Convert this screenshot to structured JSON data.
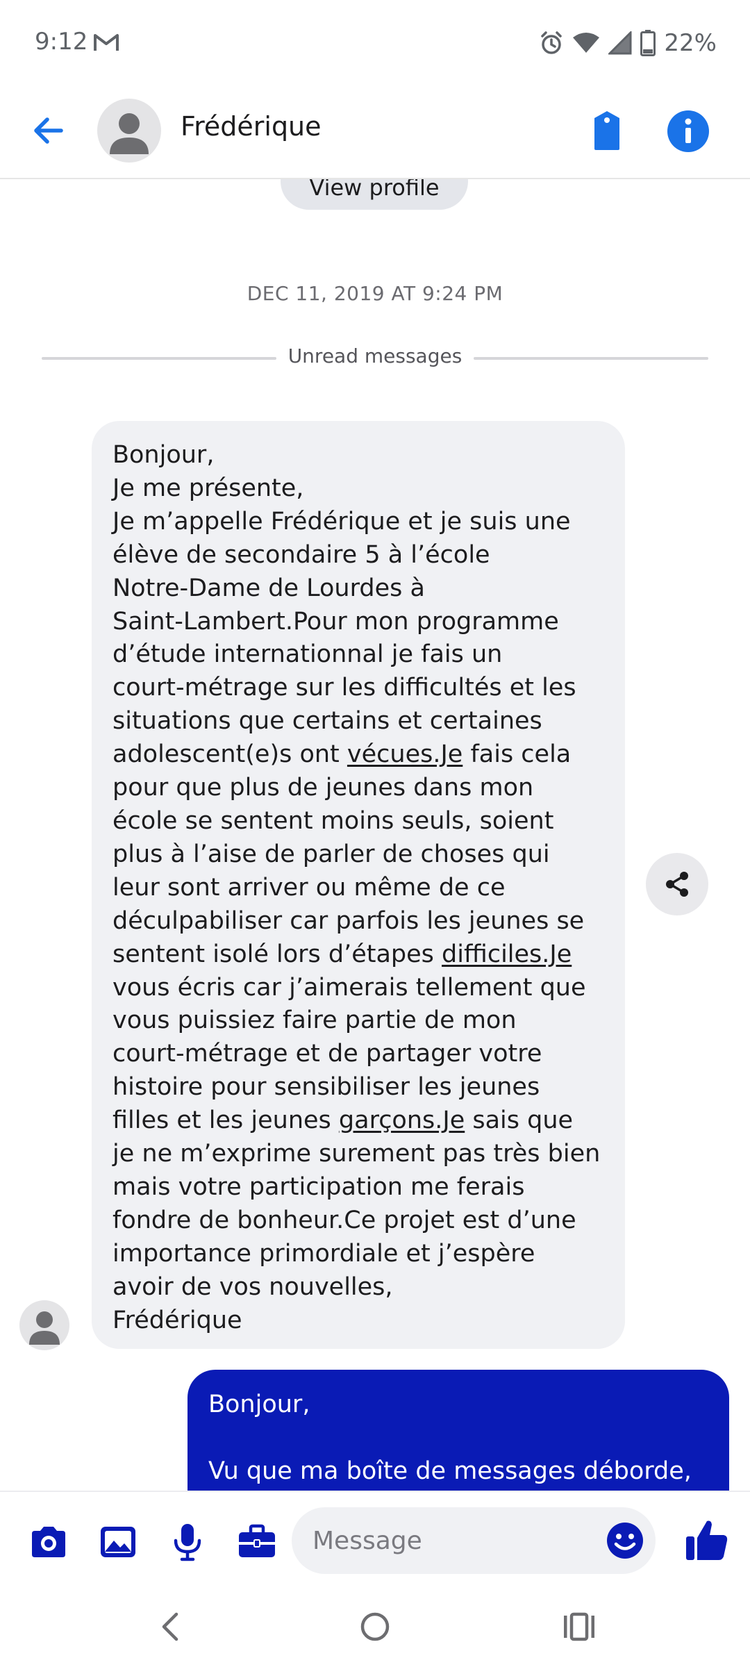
{
  "status_bar": {
    "time": "9:12",
    "battery": "22%"
  },
  "header": {
    "contact_name": "Frédérique"
  },
  "chat": {
    "view_profile_label": "View profile",
    "timestamp": "DEC 11, 2019 AT 9:24 PM",
    "unread_label": "Unread messages",
    "incoming_message": {
      "lines": [
        "Bonjour,",
        "Je me présente,",
        "Je  m’appelle Frédérique et je suis une",
        "élève de secondaire 5 à l’école",
        "Notre-Dame de Lourdes à",
        "Saint-Lambert.Pour mon programme",
        "d’étude internationnal je fais un",
        "court-métrage sur les difficultés et les",
        "situations que certains et certaines",
        "adolescent(e)s ont vécues.Je fais cela",
        "pour que plus de jeunes dans mon",
        "école se sentent moins seuls, soient",
        "plus à l’aise de parler de choses qui",
        "leur sont arriver ou même de ce",
        "déculpabiliser car parfois les jeunes se",
        "sentent isolé lors d’étapes difficiles.Je",
        "vous écris car j’aimerais tellement que",
        "vous puissiez faire partie de mon",
        "court-métrage et de partager votre",
        "histoire pour sensibiliser les jeunes",
        "filles et les jeunes garçons.Je sais que",
        "je ne m’exprime surement pas très bien",
        "mais votre participation me ferais",
        "fondre de bonheur.Ce projet est d’une",
        "importance primordiale et j’espère",
        "avoir de vos nouvelles,",
        "Frédérique"
      ]
    },
    "outgoing_message": {
      "line1": "Bonjour,",
      "line2": "Vu que ma boîte de messages déborde,"
    }
  },
  "composer": {
    "placeholder": "Message"
  },
  "colors": {
    "accent": "#1a73e8",
    "outgoing_bubble": "#0a1bb5",
    "composer_icons": "#0a1bb5",
    "incoming_bubble": "#f0f1f4"
  },
  "icons": {
    "header": [
      "back-arrow-icon",
      "tag-icon",
      "info-icon"
    ],
    "composer": [
      "camera-icon",
      "image-icon",
      "microphone-icon",
      "briefcase-icon",
      "emoji-icon",
      "thumbs-up-icon"
    ],
    "nav": [
      "back-chevron-icon",
      "home-circle-icon",
      "recents-icon"
    ]
  }
}
